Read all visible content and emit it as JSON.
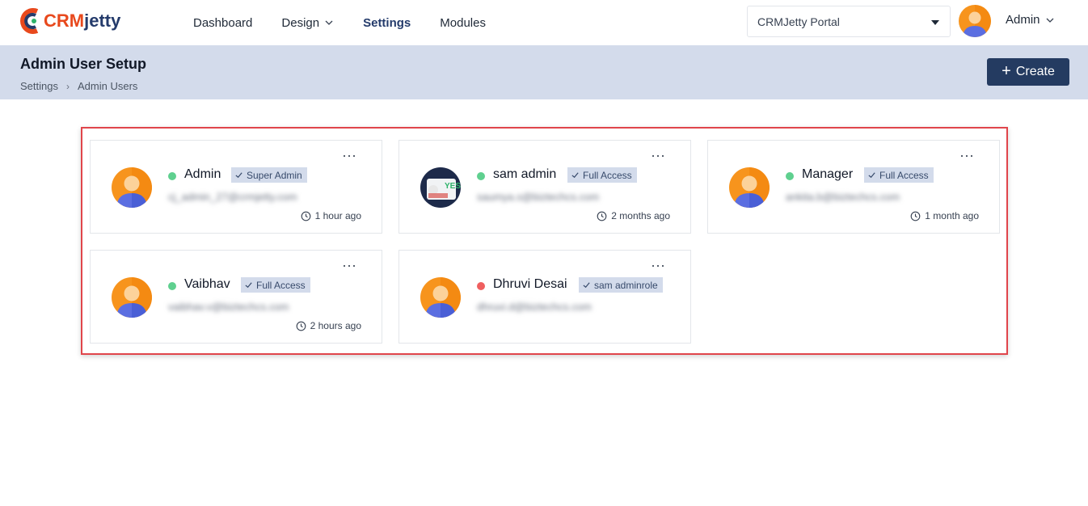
{
  "brand": {
    "logo_crm": "CRM",
    "logo_jetty": "jetty"
  },
  "nav": {
    "items": [
      {
        "label": "Dashboard",
        "dropdown": false,
        "active": false
      },
      {
        "label": "Design",
        "dropdown": true,
        "active": false
      },
      {
        "label": "Settings",
        "dropdown": false,
        "active": true
      },
      {
        "label": "Modules",
        "dropdown": false,
        "active": false
      }
    ]
  },
  "portal_select": {
    "value": "CRMJetty Portal"
  },
  "user_menu": {
    "label": "Admin"
  },
  "header": {
    "title": "Admin User Setup",
    "breadcrumb": [
      "Settings",
      "Admin Users"
    ],
    "create_label": "Create"
  },
  "colors": {
    "accent": "#243b61",
    "header_band": "#d3dbeb",
    "status_active": "#5fd08f",
    "status_inactive": "#ef5f5f",
    "highlight": "#e0454b"
  },
  "users": [
    {
      "name": "Admin",
      "role": "Super Admin",
      "email": "cj_admin_27@crmjetty.com",
      "time": "1 hour ago",
      "status": "active",
      "avatar": "default-avatar"
    },
    {
      "name": "sam admin",
      "role": "Full Access",
      "email": "saumya.s@biztechcs.com",
      "time": "2 months ago",
      "status": "active",
      "avatar": "photo-avatar"
    },
    {
      "name": "Manager",
      "role": "Full Access",
      "email": "ankita.b@biztechcs.com",
      "time": "1 month ago",
      "status": "active",
      "avatar": "default-avatar"
    },
    {
      "name": "Vaibhav",
      "role": "Full Access",
      "email": "vaibhav.v@biztechcs.com",
      "time": "2 hours ago",
      "status": "active",
      "avatar": "default-avatar"
    },
    {
      "name": "Dhruvi Desai",
      "role": "sam adminrole",
      "email": "dhruvi.d@biztechcs.com",
      "time": "",
      "status": "inactive",
      "avatar": "default-avatar"
    }
  ]
}
